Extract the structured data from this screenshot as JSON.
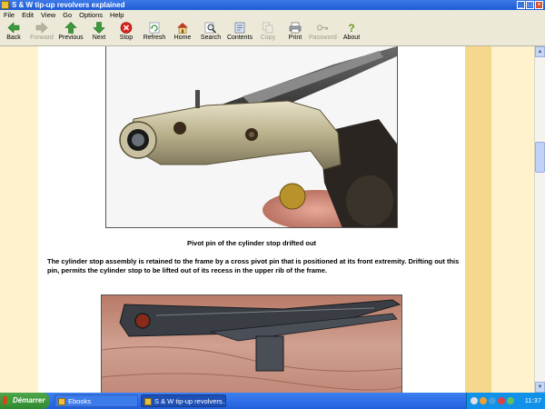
{
  "window": {
    "title": "S & W tip-up revolvers explained"
  },
  "menu": [
    "File",
    "Edit",
    "View",
    "Go",
    "Options",
    "Help"
  ],
  "toolbar": {
    "back": "Back",
    "forward": "Forward",
    "previous": "Previous",
    "next": "Next",
    "stop": "Stop",
    "refresh": "Refresh",
    "home": "Home",
    "search": "Search",
    "contents": "Contents",
    "copy": "Copy",
    "print": "Print",
    "password": "Password",
    "about": "About"
  },
  "content": {
    "caption": "Pivot pin of the cylinder stop drifted out",
    "paragraph": "The cylinder stop assembly is retained to the frame by a cross pivot pin that is positioned at its front extremity. Drifting out this pin, permits the cylinder stop to be lifted out of its recess in the upper rib of  the frame."
  },
  "taskbar": {
    "start": "Démarrer",
    "task1": "Ebooks",
    "task2": "S & W tip-up revolvers...",
    "clock": "11:37"
  },
  "colors": {
    "gutter": "#fff2cc",
    "band": "#f5d88b",
    "taskbar": "#245edb"
  }
}
